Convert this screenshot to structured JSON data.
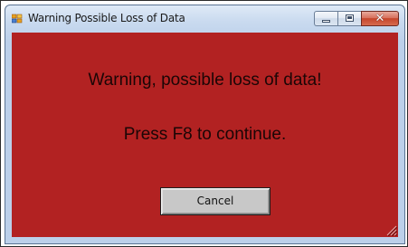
{
  "window": {
    "title": "Warning Possible Loss of Data",
    "icon": "app-window-icon"
  },
  "caption_buttons": {
    "minimize_icon": "minimize-icon",
    "maximize_icon": "maximize-icon",
    "close_icon": "close-icon",
    "close_glyph": "✕"
  },
  "dialog": {
    "background_color": "#b22222",
    "heading": "Warning, possible loss of data!",
    "instruction": "Press F8 to continue.",
    "cancel_label": "Cancel"
  }
}
